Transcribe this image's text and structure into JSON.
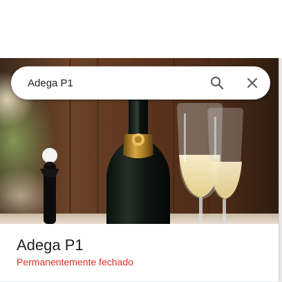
{
  "search": {
    "value": "Adega P1",
    "search_icon": "search-icon",
    "close_icon": "close-icon"
  },
  "place": {
    "name": "Adega P1",
    "status": "Permanentemente fechado"
  },
  "colors": {
    "status_closed": "#d93025",
    "title": "#202124",
    "icon": "#5f6368"
  }
}
